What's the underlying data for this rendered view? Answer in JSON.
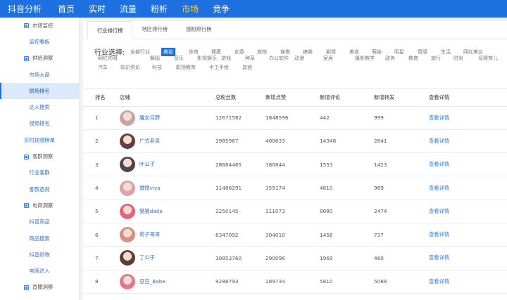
{
  "nav": {
    "brand": "抖音分析",
    "items": [
      {
        "label": "首页",
        "active": false
      },
      {
        "label": "实时",
        "active": false
      },
      {
        "label": "流量",
        "active": false
      },
      {
        "label": "粉析",
        "active": false
      },
      {
        "label": "市场",
        "active": true
      },
      {
        "label": "竞争",
        "active": false
      }
    ],
    "accent": "#1e6fe0",
    "active_color": "#ffd24a"
  },
  "sidebar": {
    "rows": [
      {
        "type": "cat",
        "label": "市场监控",
        "icon": "chart-icon"
      },
      {
        "type": "sub",
        "label": "监控看板"
      },
      {
        "type": "cat",
        "label": "供给洞察",
        "icon": "chart-icon"
      },
      {
        "type": "sub",
        "label": "市场大盘"
      },
      {
        "type": "sub",
        "label": "刷场排名",
        "active": true
      },
      {
        "type": "sub",
        "label": "达人搜索"
      },
      {
        "type": "sub",
        "label": "视频排名"
      },
      {
        "type": "sub",
        "label": "实时视频榜单"
      },
      {
        "type": "cat",
        "label": "客群洞察",
        "icon": "chart-icon"
      },
      {
        "type": "sub",
        "label": "行业客群"
      },
      {
        "type": "sub",
        "label": "客群透视"
      },
      {
        "type": "cat",
        "label": "电商洞察",
        "icon": "chart-icon"
      },
      {
        "type": "sub",
        "label": "抖音商品"
      },
      {
        "type": "sub",
        "label": "商品搜索"
      },
      {
        "type": "sub",
        "label": "抖音好物"
      },
      {
        "type": "sub",
        "label": "电商达人"
      },
      {
        "type": "cat",
        "label": "直播洞察",
        "icon": "chart-icon"
      }
    ]
  },
  "tabs": [
    {
      "label": "行业排行榜",
      "active": true
    },
    {
      "label": "地区排行榜",
      "active": false
    },
    {
      "label": "涨粉排行榜",
      "active": false
    }
  ],
  "filter": {
    "label": "行业选择:",
    "options": [
      {
        "label": "全部行业"
      },
      {
        "label": "美妆",
        "active": true
      },
      {
        "label": "体育"
      },
      {
        "label": "健康"
      },
      {
        "label": "创意"
      },
      {
        "label": "宠物"
      },
      {
        "label": "穿搭"
      },
      {
        "label": "搞笑"
      },
      {
        "label": "剧情"
      },
      {
        "label": "美食"
      },
      {
        "label": "萌娃"
      },
      {
        "label": "明星"
      },
      {
        "label": "情感"
      },
      {
        "label": "生活"
      },
      {
        "label": "网红美女"
      },
      {
        "label": "网红帅哥"
      },
      {
        "label": "舞蹈"
      },
      {
        "label": "音乐"
      },
      {
        "label": "影视娱乐"
      },
      {
        "label": "游戏"
      },
      {
        "label": "种草"
      },
      {
        "label": "办公软件"
      },
      {
        "label": "动漫"
      },
      {
        "label": "家居"
      },
      {
        "label": "摄影教学"
      },
      {
        "label": "政务"
      },
      {
        "label": "教育"
      },
      {
        "label": "旅行"
      },
      {
        "label": "时尚"
      },
      {
        "label": "母婴育儿"
      },
      {
        "label": "汽车"
      },
      {
        "label": "知识资讯"
      },
      {
        "label": "科技"
      },
      {
        "label": "职场教育"
      },
      {
        "label": "手工手绘"
      },
      {
        "label": "其他"
      }
    ]
  },
  "table": {
    "headers": [
      "排名",
      "店铺",
      "总粉丝数",
      "新增点赞",
      "新增评论",
      "新增转发",
      "查看详情"
    ],
    "rows": [
      {
        "rank": "1",
        "name": "魔女月野",
        "fans": "12671582",
        "likes": "1848596",
        "comments": "442",
        "forwards": "999",
        "detail": "查看详情",
        "avatar_color": "#c9a3a8"
      },
      {
        "rank": "2",
        "name": "广式老吴",
        "fans": "1985967",
        "likes": "400633",
        "comments": "14348",
        "forwards": "2841",
        "detail": "查看详情",
        "avatar_color": "#6b3b3b"
      },
      {
        "rank": "3",
        "name": "叶公子",
        "fans": "28684465",
        "likes": "380844",
        "comments": "1553",
        "forwards": "1423",
        "detail": "查看详情",
        "avatar_color": "#4a4a4a"
      },
      {
        "rank": "4",
        "name": "微微viya",
        "fans": "11486291",
        "likes": "355174",
        "comments": "4810",
        "forwards": "969",
        "detail": "查看详情",
        "avatar_color": "#d8a4a8"
      },
      {
        "rank": "5",
        "name": "猫猫dada",
        "fans": "2250145",
        "likes": "311073",
        "comments": "8080",
        "forwards": "2474",
        "detail": "查看详情",
        "avatar_color": "#e0667a"
      },
      {
        "rank": "6",
        "name": "荀子哥哥",
        "fans": "6347092",
        "likes": "304010",
        "comments": "1456",
        "forwards": "737",
        "detail": "查看详情",
        "avatar_color": "#d98c80"
      },
      {
        "rank": "7",
        "name": "丁公子",
        "fans": "10853760",
        "likes": "290096",
        "comments": "1969",
        "forwards": "460",
        "detail": "查看详情",
        "avatar_color": "#5a4038"
      },
      {
        "rank": "8",
        "name": "豆豆_Babe",
        "fans": "9288793",
        "likes": "289734",
        "comments": "5810",
        "forwards": "5088",
        "detail": "查看详情",
        "avatar_color": "#e07890"
      }
    ]
  }
}
